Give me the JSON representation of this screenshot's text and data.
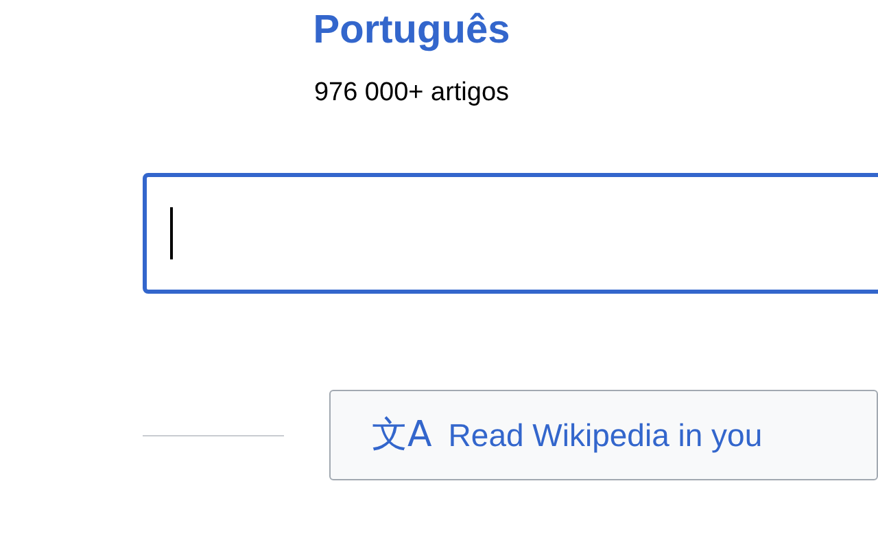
{
  "header": {
    "language": "Português",
    "article_count": "976 000+ artigos"
  },
  "search": {
    "focused": true
  },
  "language_button": {
    "icon": "文A",
    "label": "Read Wikipedia in you"
  }
}
